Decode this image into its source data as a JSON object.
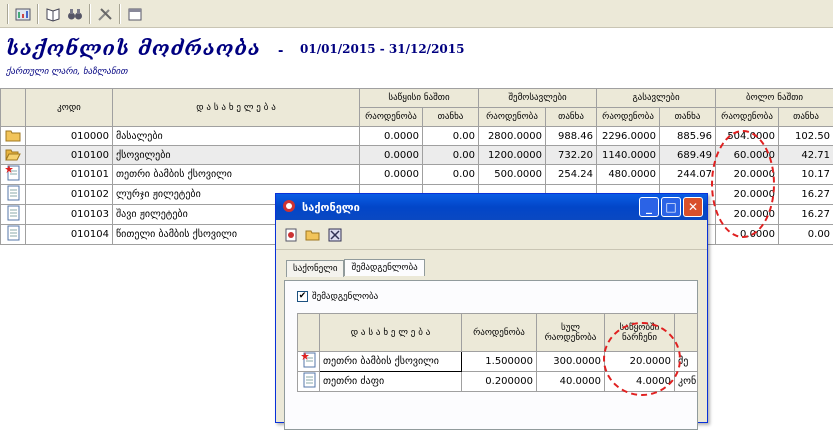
{
  "toolbar": {
    "icons": [
      "report-icon",
      "book-icon",
      "binoculars-icon",
      "tools-icon",
      "window-icon"
    ]
  },
  "header": {
    "title": "საქონლის მოძრაობა",
    "dash": "-",
    "period": "01/01/2015 - 31/12/2015",
    "subtitle": "ქართული ლარი, ხაზლანით"
  },
  "grid": {
    "col_code": "კოდი",
    "col_name": "დ ა ს ა ხ ე ლ ე ბ ა",
    "groups": [
      "საწყისი ნაშთი",
      "შემოსავლები",
      "გასავლები",
      "ბოლო ნაშთი"
    ],
    "sub_qty": "რაოდენობა",
    "sub_sum": "თანხა",
    "rows": [
      {
        "icon": "folder-icon",
        "code": "010000",
        "name": "მასალები",
        "v": [
          "0.0000",
          "0.00",
          "2800.0000",
          "988.46",
          "2296.0000",
          "885.96",
          "504.0000",
          "102.50"
        ]
      },
      {
        "icon": "folder-open-icon",
        "code": "010100",
        "name": "ქსოვილები",
        "v": [
          "0.0000",
          "0.00",
          "1200.0000",
          "732.20",
          "1140.0000",
          "689.49",
          "60.0000",
          "42.71"
        ]
      },
      {
        "icon": "document-star-icon",
        "code": "010101",
        "name": "თეთრი ბამბის ქსოვილი",
        "v": [
          "0.0000",
          "0.00",
          "500.0000",
          "254.24",
          "480.0000",
          "244.07",
          "20.0000",
          "10.17"
        ]
      },
      {
        "icon": "document-icon",
        "code": "010102",
        "name": "ლურჯი ჟილეტები",
        "v": [
          "",
          "",
          "",
          "",
          "",
          "",
          "20.0000",
          "16.27"
        ]
      },
      {
        "icon": "document-icon",
        "code": "010103",
        "name": "შავი ჟილეტები",
        "v": [
          "",
          "",
          "",
          "",
          "",
          "",
          "20.0000",
          "16.27"
        ]
      },
      {
        "icon": "document-icon",
        "code": "010104",
        "name": "წითელი ბამბის ქსოვილი",
        "v": [
          "",
          "",
          "",
          "",
          "",
          "",
          "0.0000",
          "0.00"
        ]
      }
    ]
  },
  "dialog": {
    "title": "საქონელი",
    "tabs": [
      "საქონელი",
      "შემადგენლობა"
    ],
    "checkbox_label": "შემადგენლობა",
    "checkbox_mark": "✔",
    "columns": [
      "დ ა ს ა ხ ე ლ ე ბ ა",
      "რაოდენობა",
      "სულ რაოდენობა",
      "საწყობში ნარჩენი"
    ],
    "rows": [
      {
        "icon": "document-star-icon",
        "name": "თეთრი ბამბის ქსოვილი",
        "qty": "1.500000",
        "total": "300.0000",
        "stock": "20.0000",
        "extra": "მე"
      },
      {
        "icon": "document-icon",
        "name": "თეთრი ძაფი",
        "qty": "0.200000",
        "total": "40.0000",
        "stock": "4.0000",
        "extra": "კონ"
      }
    ]
  },
  "colors": {
    "title": "#000080",
    "annotation": "#e02020",
    "titlebar": "#0246c8"
  }
}
